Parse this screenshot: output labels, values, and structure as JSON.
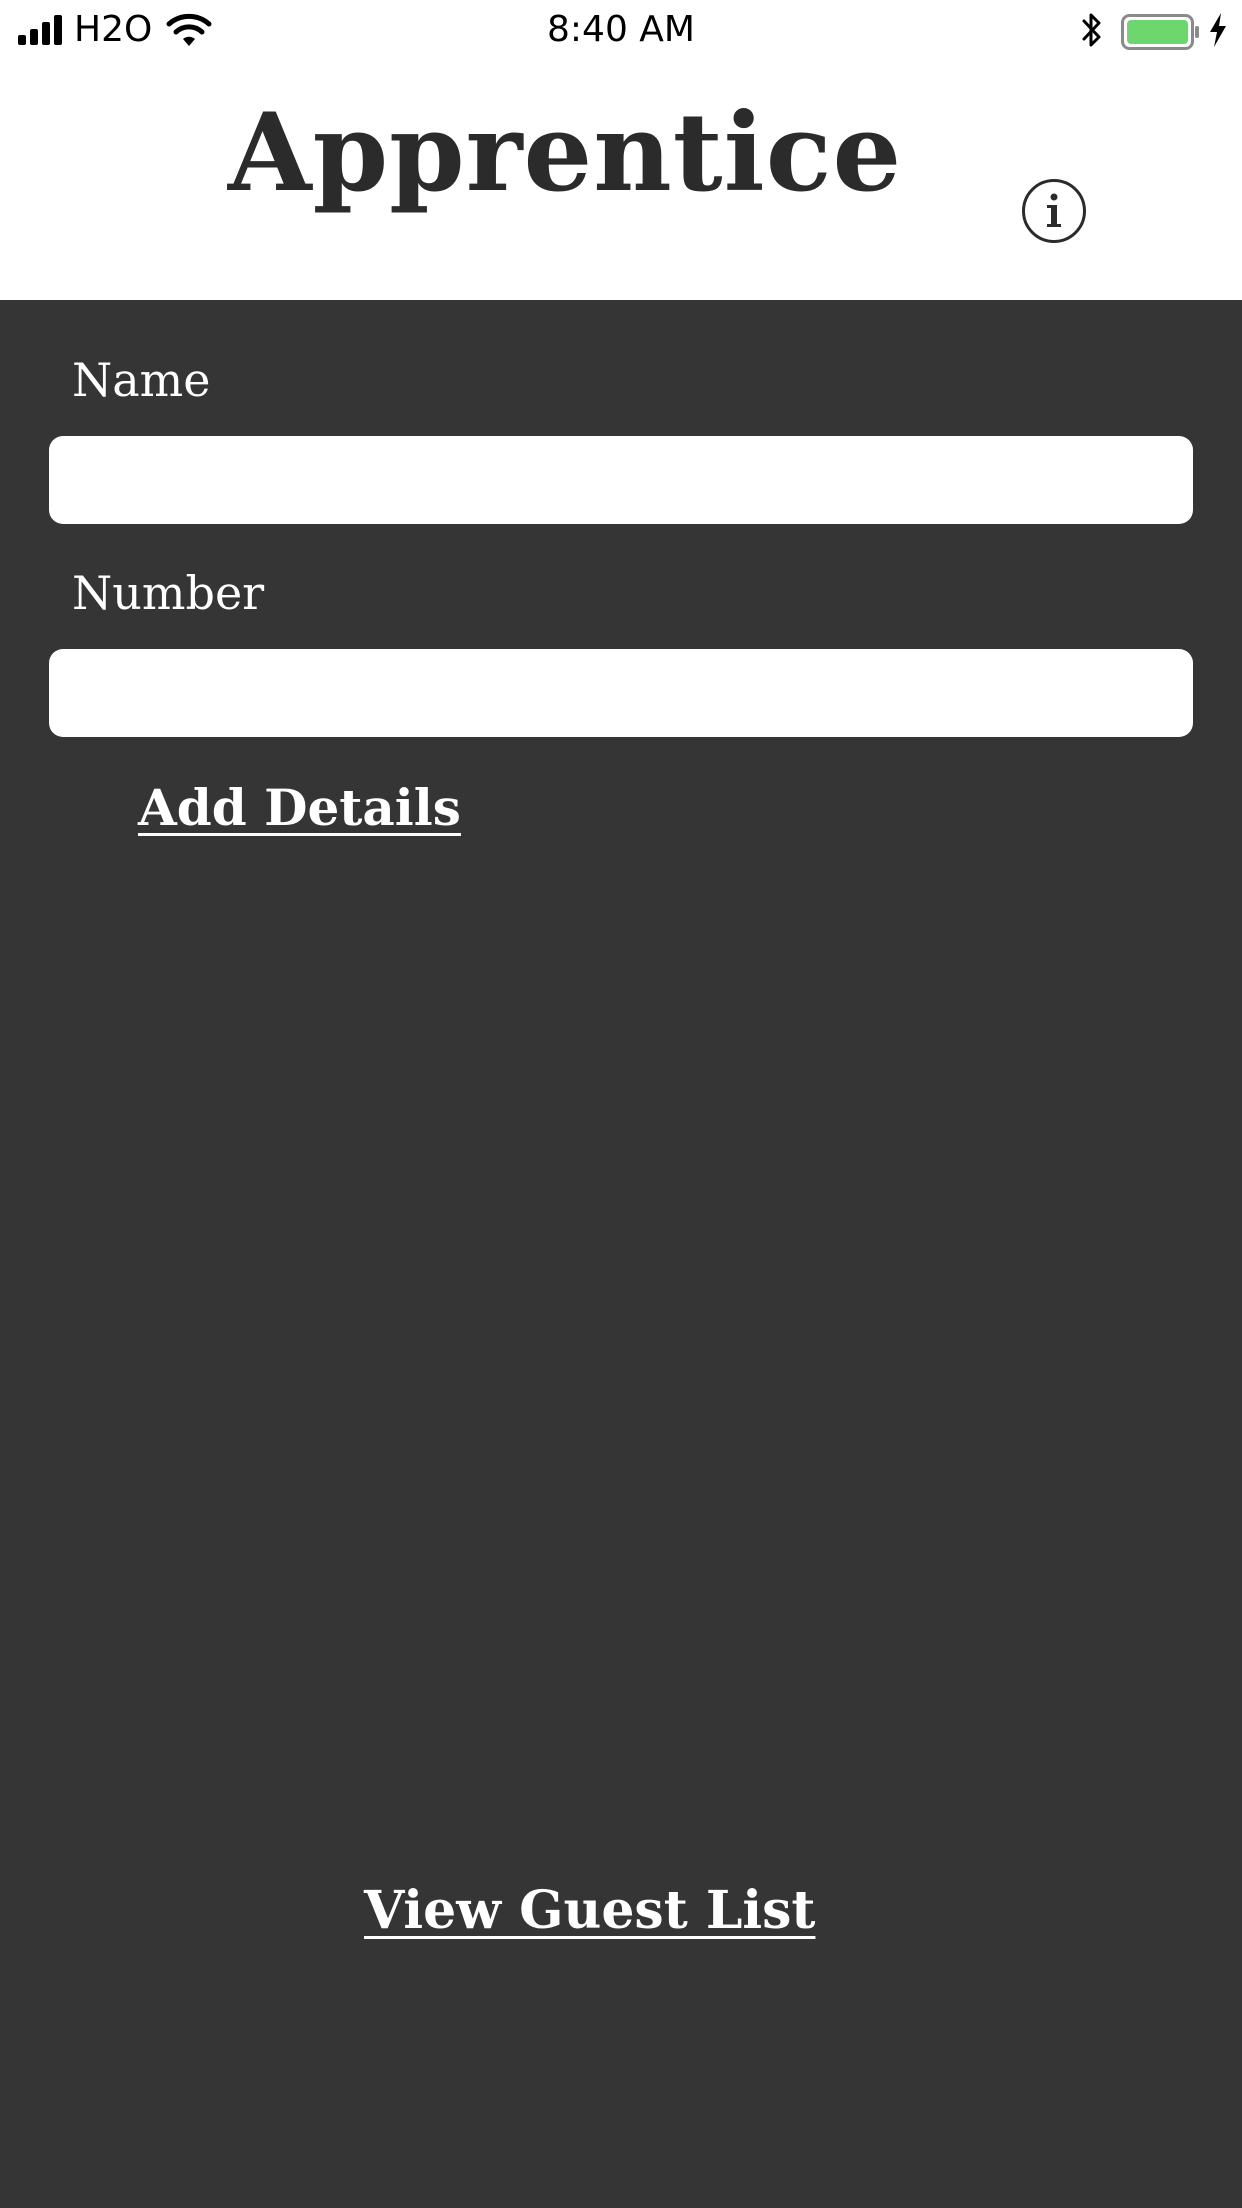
{
  "status_bar": {
    "carrier": "H2O",
    "time": "8:40 AM",
    "battery_color": "#6ed66e",
    "icons": [
      "signal-icon",
      "wifi-icon",
      "bluetooth-icon",
      "battery-icon",
      "charging-icon"
    ]
  },
  "header": {
    "title": "Apprentice",
    "info_icon": "info-icon"
  },
  "form": {
    "name_label": "Name",
    "name_value": "",
    "number_label": "Number",
    "number_value": "",
    "add_details_label": "Add Details"
  },
  "footer": {
    "view_guest_list_label": "View Guest List"
  },
  "colors": {
    "background": "#353535",
    "header_background": "#ffffff",
    "title_text": "#2b2b2b",
    "label_text": "#ffffff"
  }
}
